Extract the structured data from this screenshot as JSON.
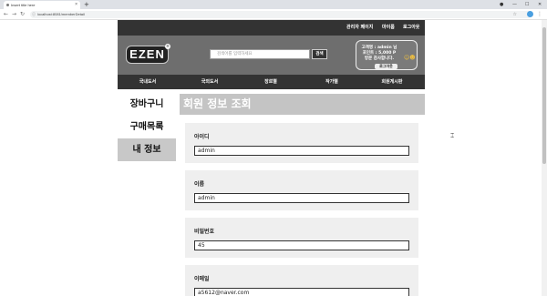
{
  "browser": {
    "tab_title": "Insert title here",
    "url": "localhost:8081/memberDetail"
  },
  "site": {
    "top_links": [
      "관리자 페이지",
      "마이룸",
      "로그아웃"
    ],
    "logo": "EZEN",
    "search": {
      "placeholder": "검색어를 입력하세요",
      "button": "검색"
    },
    "user": {
      "greeting": "고객명 : admin 님",
      "points": "포인트 : 5,000 P",
      "thanks": "방문 감사합니다.",
      "logout": "로그아웃"
    },
    "categories": [
      "국내도서",
      "국외도서",
      "장르별",
      "작가별",
      "회원게시판"
    ]
  },
  "side_menu": [
    "장바구니",
    "구매목록",
    "내 정보"
  ],
  "page_title": "회원 정보 조회",
  "fields": [
    {
      "label": "아이디",
      "value": "admin"
    },
    {
      "label": "이름",
      "value": "admin"
    },
    {
      "label": "비밀번호",
      "value": "45"
    },
    {
      "label": "이메일",
      "value": "a5612@naver.com"
    }
  ]
}
